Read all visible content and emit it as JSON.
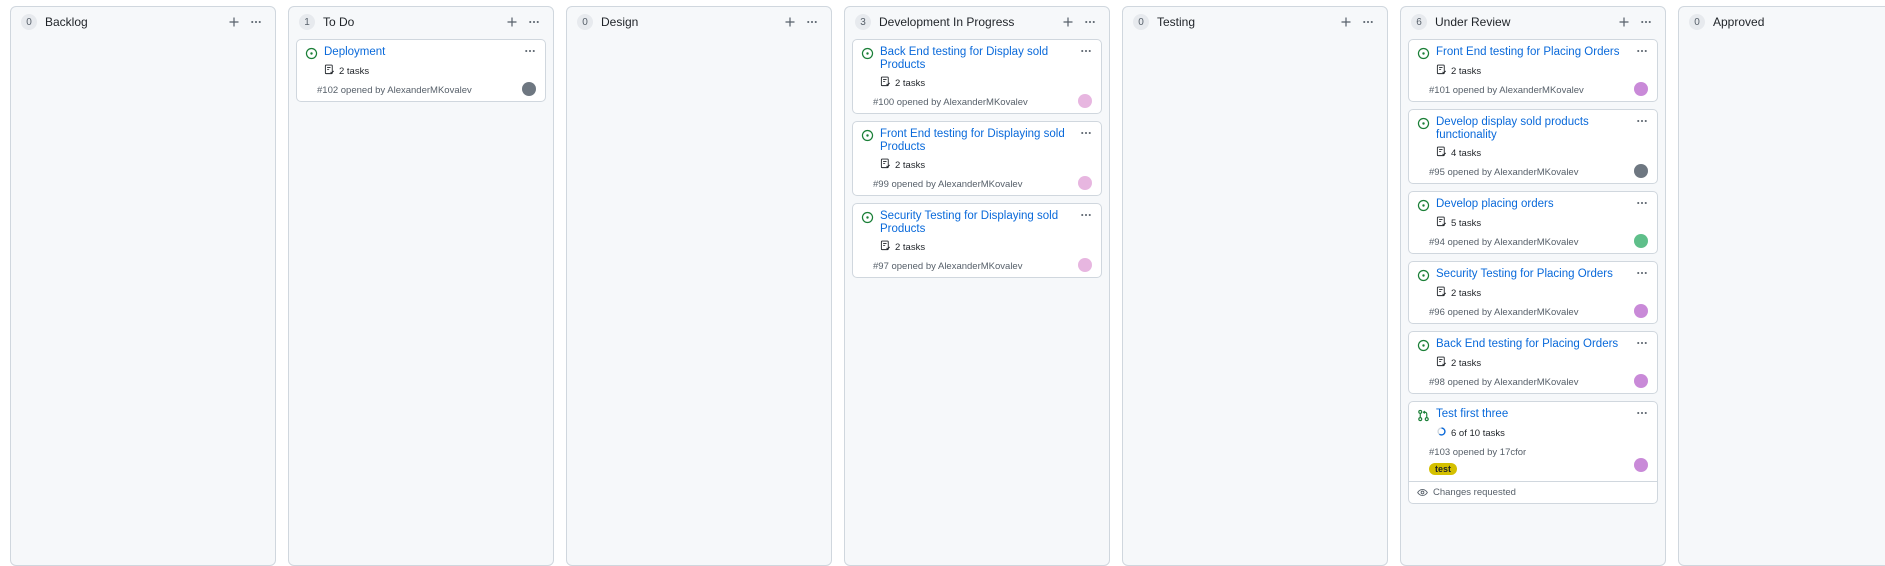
{
  "columns": [
    {
      "title": "Backlog",
      "count": "0",
      "cards": []
    },
    {
      "title": "To Do",
      "count": "1",
      "cards": [
        {
          "title": "Deployment",
          "tasks": "2 tasks",
          "meta": "#102 opened by AlexanderMKovalev",
          "avatar": "gray"
        }
      ]
    },
    {
      "title": "Design",
      "count": "0",
      "cards": []
    },
    {
      "title": "Development In Progress",
      "count": "3",
      "cards": [
        {
          "title": "Back End testing for Display sold Products",
          "tasks": "2 tasks",
          "meta": "#100 opened by AlexanderMKovalev",
          "avatar": "pink"
        },
        {
          "title": "Front End testing for Displaying sold Products",
          "tasks": "2 tasks",
          "meta": "#99 opened by AlexanderMKovalev",
          "avatar": "pink"
        },
        {
          "title": "Security Testing for Displaying sold Products",
          "tasks": "2 tasks",
          "meta": "#97 opened by AlexanderMKovalev",
          "avatar": "pink"
        }
      ]
    },
    {
      "title": "Testing",
      "count": "0",
      "cards": []
    },
    {
      "title": "Under Review",
      "count": "6",
      "cards": [
        {
          "title": "Front End testing for Placing Orders",
          "tasks": "2 tasks",
          "meta": "#101 opened by AlexanderMKovalev",
          "avatar": "purple"
        },
        {
          "title": "Develop display sold products functionality",
          "tasks": "4 tasks",
          "meta": "#95 opened by AlexanderMKovalev",
          "avatar": "gray"
        },
        {
          "title": "Develop placing orders",
          "tasks": "5 tasks",
          "meta": "#94 opened by AlexanderMKovalev",
          "avatar": "green"
        },
        {
          "title": "Security Testing for Placing Orders",
          "tasks": "2 tasks",
          "meta": "#96 opened by AlexanderMKovalev",
          "avatar": "purple"
        },
        {
          "title": "Back End testing for Placing Orders",
          "tasks": "2 tasks",
          "meta": "#98 opened by AlexanderMKovalev",
          "avatar": "purple"
        },
        {
          "title": "Test first three",
          "tasks": "6 of 10 tasks",
          "progress": 0.6,
          "meta": "#103 opened by 17cfor",
          "avatar": "purple",
          "type": "pr",
          "label": "test",
          "footer": "Changes requested"
        }
      ]
    },
    {
      "title": "Approved",
      "count": "0",
      "cards": []
    }
  ],
  "colors": {
    "link": "#0969da",
    "open_green": "#1a7f37",
    "label_yellow": "#d4c000",
    "avatar_pink": "#e7b6e0",
    "avatar_purple": "#c98ad8",
    "avatar_green": "#5fbf8a",
    "avatar_gray": "#6e7781"
  }
}
